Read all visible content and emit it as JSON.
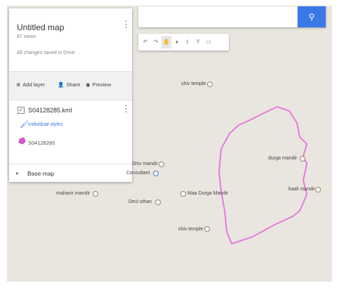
{
  "panel": {
    "title": "Untitled map",
    "views": "87 views",
    "saved": "All changes saved in Drive",
    "actions": {
      "add_layer": "Add layer",
      "share": "Share",
      "preview": "Preview"
    },
    "layer": {
      "name": "S04128285.kml",
      "styles": "Individual styles",
      "item": "S04128285"
    },
    "base_map": "Base map"
  },
  "search": {
    "value": "",
    "button_icon": "search-icon"
  },
  "toolbar": {
    "icons": [
      "undo-icon",
      "redo-icon",
      "hand-icon",
      "marker-icon",
      "draw-line-icon",
      "directions-icon",
      "ruler-icon"
    ]
  },
  "places": {
    "shiv_temple_top": "shiv temple",
    "shiv_mandir": "Shiv mandir",
    "consultant": "Consultant",
    "durga_mandir": "durga mandir",
    "kaali_mandir": "kaali mandir",
    "mahavir_mandir": "mahavir mandir",
    "devi_sthan": "Devi sthan",
    "maa_durga_mandir": "Maa Durga Mandir",
    "shiv_temple_bottom": "shiv temple"
  },
  "colors": {
    "accent": "#3b78e7",
    "polygon": "#e87ae0",
    "map_bg": "#e9e6df"
  }
}
